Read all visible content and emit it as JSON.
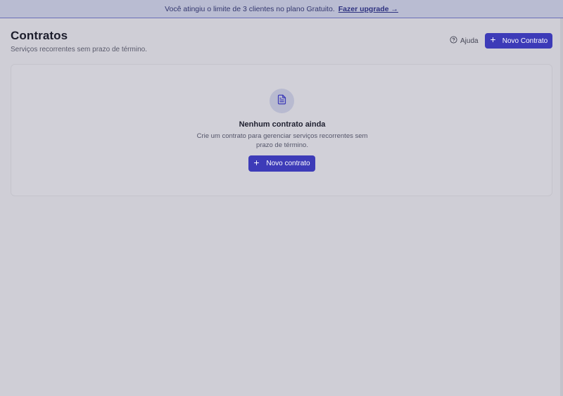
{
  "banner": {
    "message": "Você atingiu o limite de 3 clientes no plano Gratuito.",
    "link": "Fazer upgrade →"
  },
  "header": {
    "title": "Contratos",
    "subtitle": "Serviços recorrentes sem prazo de término."
  },
  "toolbar": {
    "help_label": "Ajuda",
    "new_contract_label": "Novo Contrato"
  },
  "empty_state": {
    "title": "Nenhum contrato ainda",
    "description": "Crie um contrato para gerenciar serviços recorrentes sem prazo de término.",
    "button_label": "Novo contrato"
  },
  "icons": {
    "help": "help-circle-icon",
    "plus": "plus-icon",
    "document": "file-text-icon"
  },
  "colors": {
    "accent": "#3d3bb8",
    "banner_bg": "#b9bcd2",
    "page_bg": "#cfced6"
  }
}
